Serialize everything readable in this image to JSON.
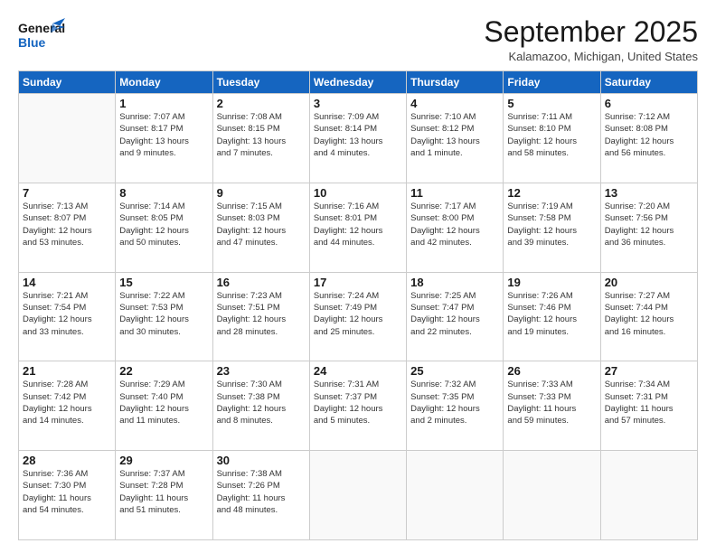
{
  "header": {
    "logo_general": "General",
    "logo_blue": "Blue",
    "month_title": "September 2025",
    "location": "Kalamazoo, Michigan, United States"
  },
  "weekdays": [
    "Sunday",
    "Monday",
    "Tuesday",
    "Wednesday",
    "Thursday",
    "Friday",
    "Saturday"
  ],
  "weeks": [
    [
      {
        "day": "",
        "info": ""
      },
      {
        "day": "1",
        "info": "Sunrise: 7:07 AM\nSunset: 8:17 PM\nDaylight: 13 hours\nand 9 minutes."
      },
      {
        "day": "2",
        "info": "Sunrise: 7:08 AM\nSunset: 8:15 PM\nDaylight: 13 hours\nand 7 minutes."
      },
      {
        "day": "3",
        "info": "Sunrise: 7:09 AM\nSunset: 8:14 PM\nDaylight: 13 hours\nand 4 minutes."
      },
      {
        "day": "4",
        "info": "Sunrise: 7:10 AM\nSunset: 8:12 PM\nDaylight: 13 hours\nand 1 minute."
      },
      {
        "day": "5",
        "info": "Sunrise: 7:11 AM\nSunset: 8:10 PM\nDaylight: 12 hours\nand 58 minutes."
      },
      {
        "day": "6",
        "info": "Sunrise: 7:12 AM\nSunset: 8:08 PM\nDaylight: 12 hours\nand 56 minutes."
      }
    ],
    [
      {
        "day": "7",
        "info": "Sunrise: 7:13 AM\nSunset: 8:07 PM\nDaylight: 12 hours\nand 53 minutes."
      },
      {
        "day": "8",
        "info": "Sunrise: 7:14 AM\nSunset: 8:05 PM\nDaylight: 12 hours\nand 50 minutes."
      },
      {
        "day": "9",
        "info": "Sunrise: 7:15 AM\nSunset: 8:03 PM\nDaylight: 12 hours\nand 47 minutes."
      },
      {
        "day": "10",
        "info": "Sunrise: 7:16 AM\nSunset: 8:01 PM\nDaylight: 12 hours\nand 44 minutes."
      },
      {
        "day": "11",
        "info": "Sunrise: 7:17 AM\nSunset: 8:00 PM\nDaylight: 12 hours\nand 42 minutes."
      },
      {
        "day": "12",
        "info": "Sunrise: 7:19 AM\nSunset: 7:58 PM\nDaylight: 12 hours\nand 39 minutes."
      },
      {
        "day": "13",
        "info": "Sunrise: 7:20 AM\nSunset: 7:56 PM\nDaylight: 12 hours\nand 36 minutes."
      }
    ],
    [
      {
        "day": "14",
        "info": "Sunrise: 7:21 AM\nSunset: 7:54 PM\nDaylight: 12 hours\nand 33 minutes."
      },
      {
        "day": "15",
        "info": "Sunrise: 7:22 AM\nSunset: 7:53 PM\nDaylight: 12 hours\nand 30 minutes."
      },
      {
        "day": "16",
        "info": "Sunrise: 7:23 AM\nSunset: 7:51 PM\nDaylight: 12 hours\nand 28 minutes."
      },
      {
        "day": "17",
        "info": "Sunrise: 7:24 AM\nSunset: 7:49 PM\nDaylight: 12 hours\nand 25 minutes."
      },
      {
        "day": "18",
        "info": "Sunrise: 7:25 AM\nSunset: 7:47 PM\nDaylight: 12 hours\nand 22 minutes."
      },
      {
        "day": "19",
        "info": "Sunrise: 7:26 AM\nSunset: 7:46 PM\nDaylight: 12 hours\nand 19 minutes."
      },
      {
        "day": "20",
        "info": "Sunrise: 7:27 AM\nSunset: 7:44 PM\nDaylight: 12 hours\nand 16 minutes."
      }
    ],
    [
      {
        "day": "21",
        "info": "Sunrise: 7:28 AM\nSunset: 7:42 PM\nDaylight: 12 hours\nand 14 minutes."
      },
      {
        "day": "22",
        "info": "Sunrise: 7:29 AM\nSunset: 7:40 PM\nDaylight: 12 hours\nand 11 minutes."
      },
      {
        "day": "23",
        "info": "Sunrise: 7:30 AM\nSunset: 7:38 PM\nDaylight: 12 hours\nand 8 minutes."
      },
      {
        "day": "24",
        "info": "Sunrise: 7:31 AM\nSunset: 7:37 PM\nDaylight: 12 hours\nand 5 minutes."
      },
      {
        "day": "25",
        "info": "Sunrise: 7:32 AM\nSunset: 7:35 PM\nDaylight: 12 hours\nand 2 minutes."
      },
      {
        "day": "26",
        "info": "Sunrise: 7:33 AM\nSunset: 7:33 PM\nDaylight: 11 hours\nand 59 minutes."
      },
      {
        "day": "27",
        "info": "Sunrise: 7:34 AM\nSunset: 7:31 PM\nDaylight: 11 hours\nand 57 minutes."
      }
    ],
    [
      {
        "day": "28",
        "info": "Sunrise: 7:36 AM\nSunset: 7:30 PM\nDaylight: 11 hours\nand 54 minutes."
      },
      {
        "day": "29",
        "info": "Sunrise: 7:37 AM\nSunset: 7:28 PM\nDaylight: 11 hours\nand 51 minutes."
      },
      {
        "day": "30",
        "info": "Sunrise: 7:38 AM\nSunset: 7:26 PM\nDaylight: 11 hours\nand 48 minutes."
      },
      {
        "day": "",
        "info": ""
      },
      {
        "day": "",
        "info": ""
      },
      {
        "day": "",
        "info": ""
      },
      {
        "day": "",
        "info": ""
      }
    ]
  ]
}
